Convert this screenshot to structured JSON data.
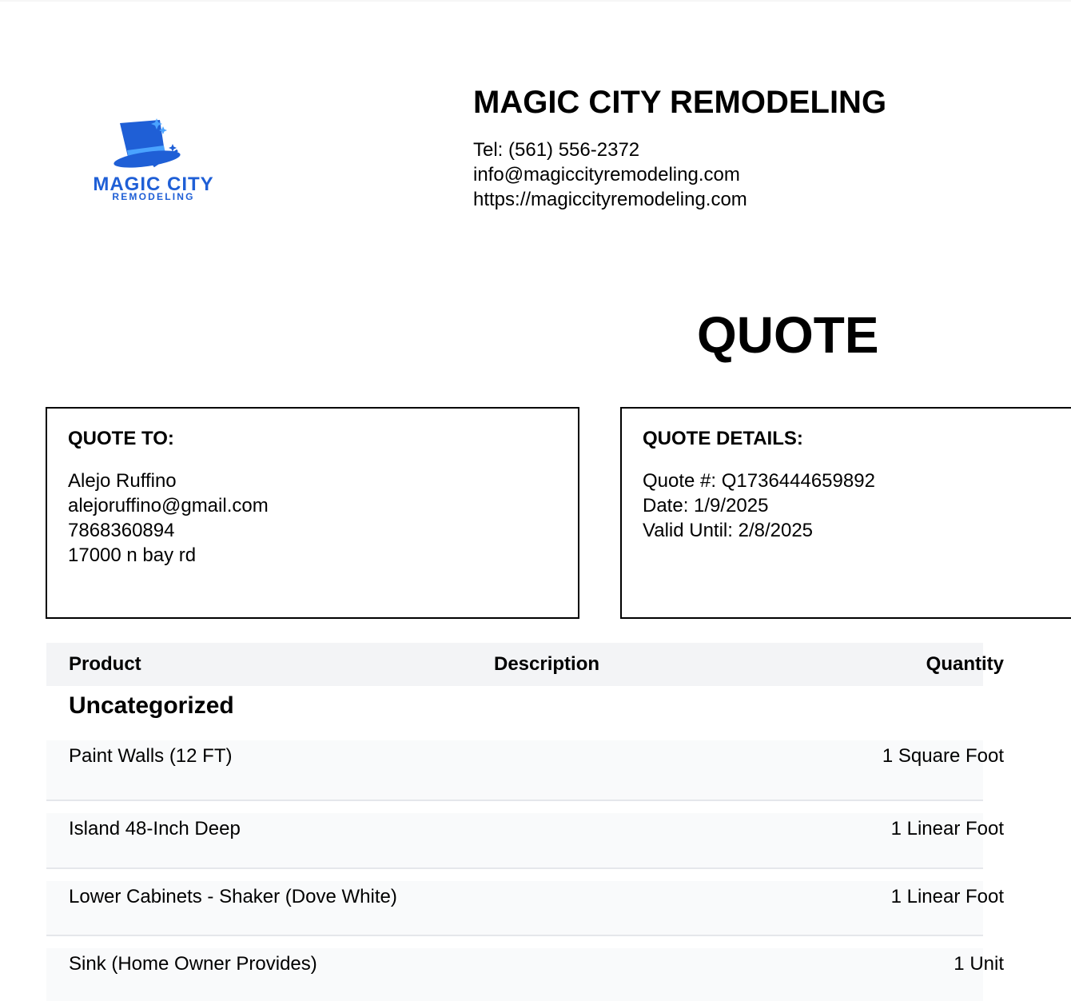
{
  "company": {
    "logo_text_main": "MAGIC CITY",
    "logo_text_sub": "REMODELING",
    "name": "MAGIC CITY REMODELING",
    "tel": "Tel: (561) 556-2372",
    "email": "info@magiccityremodeling.com",
    "website": "https://magiccityremodeling.com"
  },
  "document": {
    "title": "QUOTE"
  },
  "quote_to": {
    "heading": "QUOTE TO:",
    "name": "Alejo Ruffino",
    "email": "alejoruffino@gmail.com",
    "phone": "7868360894",
    "address": "17000 n bay rd"
  },
  "quote_details": {
    "heading": "QUOTE DETAILS:",
    "number": "Quote #: Q1736444659892",
    "date": "Date: 1/9/2025",
    "valid_until": "Valid Until: 2/8/2025"
  },
  "table": {
    "headers": {
      "product": "Product",
      "description": "Description",
      "quantity": "Quantity"
    },
    "category": "Uncategorized",
    "rows": [
      {
        "product": "Paint Walls (12 FT)",
        "quantity": "1 Square Foot"
      },
      {
        "product": "Island 48-Inch Deep",
        "quantity": "1 Linear Foot"
      },
      {
        "product": "Lower Cabinets - Shaker (Dove White)",
        "quantity": "1 Linear Foot"
      },
      {
        "product": "Sink (Home Owner Provides)",
        "quantity": "1 Unit"
      }
    ]
  },
  "colors": {
    "logo_blue": "#1f5fd6",
    "logo_light_blue": "#4aa3ff",
    "header_bg": "#f3f4f6",
    "row_bg": "#f9fafb"
  }
}
